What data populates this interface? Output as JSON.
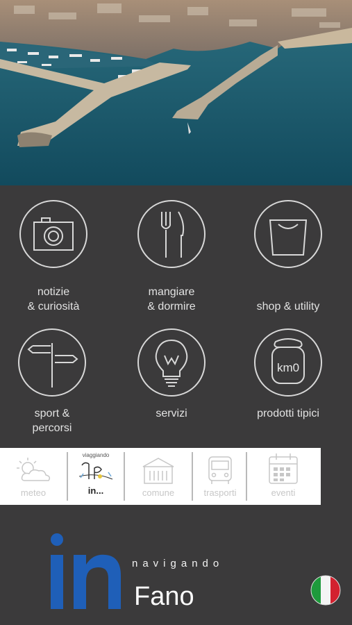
{
  "hero": {
    "alt": "aerial harbour photo"
  },
  "tiles": [
    {
      "label": "notizie\n& curiosità",
      "icon": "camera-icon"
    },
    {
      "label": "mangiare\n& dormire",
      "icon": "fork-knife-icon"
    },
    {
      "label": "shop & utility",
      "icon": "shopping-bag-icon"
    },
    {
      "label": "sport &\npercorsi",
      "icon": "signpost-icon"
    },
    {
      "label": "servizi",
      "icon": "lightbulb-icon"
    },
    {
      "label": "prodotti tipici",
      "icon": "jar-km0-icon"
    }
  ],
  "jar_text": "km0",
  "bar": {
    "items": [
      {
        "label": "meteo",
        "icon": "weather-icon"
      },
      {
        "label": "in...",
        "icon": "viaggiando-icon",
        "top_text": "viaggiando"
      },
      {
        "label": "comune",
        "icon": "townhall-icon"
      },
      {
        "label": "trasporti",
        "icon": "bus-icon"
      },
      {
        "label": "eventi",
        "icon": "calendar-icon"
      }
    ]
  },
  "footer": {
    "logo": "in",
    "navigando": "navigando",
    "city": "Fano",
    "language_flag": "italian-flag-icon"
  },
  "colors": {
    "background": "#3b3a3b",
    "logo_blue": "#1f5fb8",
    "bar": "#ffffff"
  }
}
